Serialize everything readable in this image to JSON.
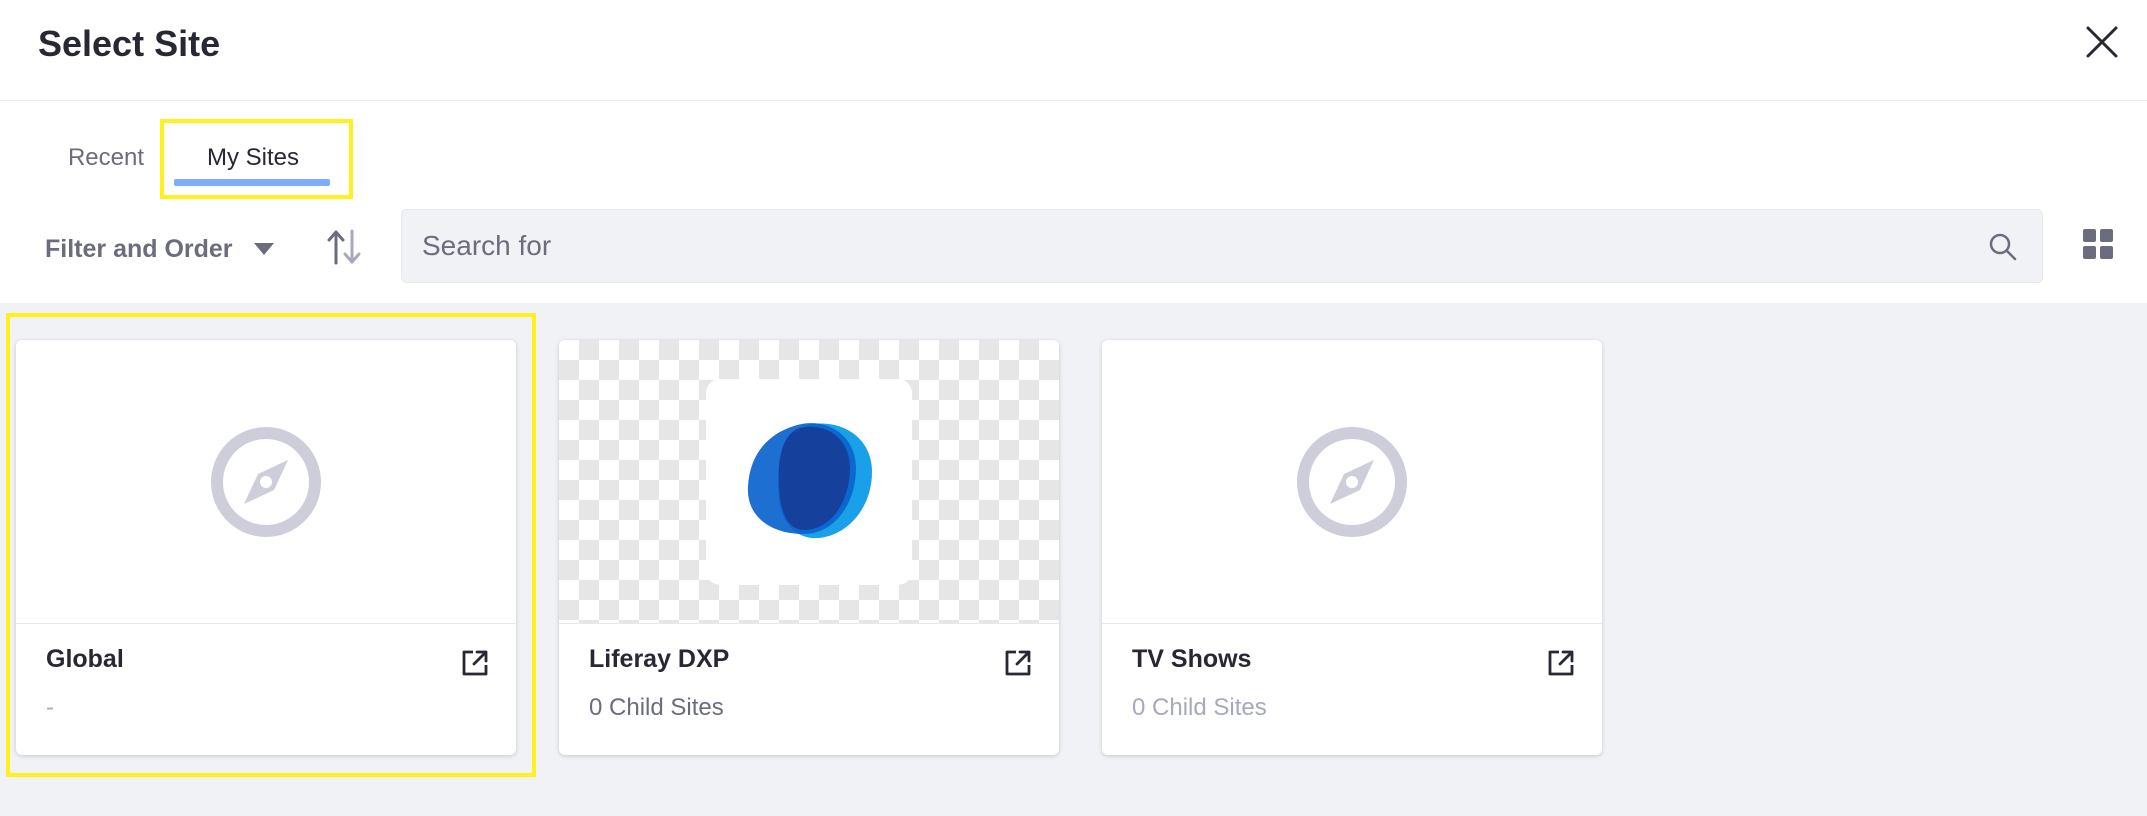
{
  "header": {
    "title": "Select Site"
  },
  "tabs": [
    {
      "label": "Recent",
      "active": false
    },
    {
      "label": "My Sites",
      "active": true
    }
  ],
  "toolbar": {
    "filter_label": "Filter and Order",
    "search_placeholder": "Search for"
  },
  "sites": [
    {
      "name": "Global",
      "subtitle": "-",
      "image": "compass-icon"
    },
    {
      "name": "Liferay DXP",
      "subtitle": "0 Child Sites",
      "image": "liferay-logo"
    },
    {
      "name": "TV Shows",
      "subtitle": "0 Child Sites",
      "image": "compass-icon"
    }
  ],
  "colors": {
    "accent_underline": "#80acff",
    "highlight": "#fff01e",
    "logo_dark": "#15419c",
    "logo_mid": "#0b63ce",
    "logo_light": "#1aa0e8"
  }
}
